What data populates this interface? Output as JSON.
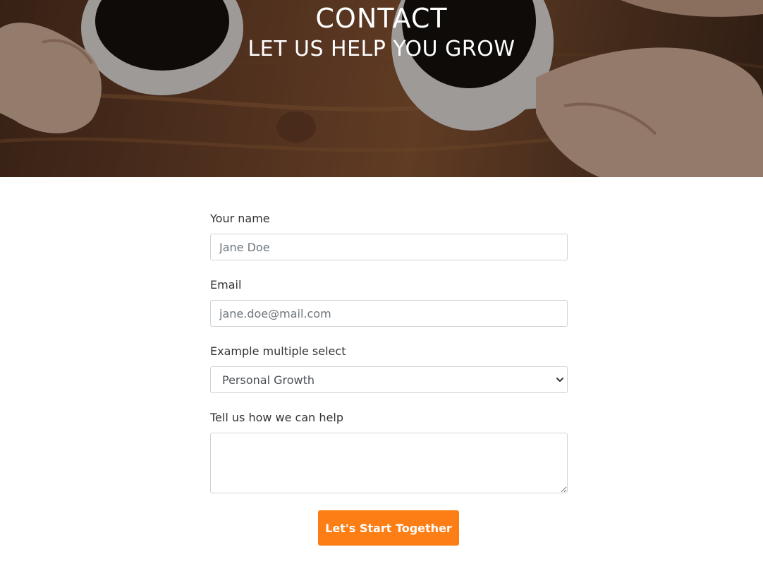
{
  "hero": {
    "title": "CONTACT",
    "subtitle": "LET US HELP YOU GROW"
  },
  "form": {
    "name": {
      "label": "Your name",
      "placeholder": "Jane Doe",
      "value": ""
    },
    "email": {
      "label": "Email",
      "placeholder": "jane.doe@mail.com",
      "value": ""
    },
    "select": {
      "label": "Example multiple select",
      "selected": "Personal Growth",
      "icon": "chevron-down-icon"
    },
    "message": {
      "label": "Tell us how we can help",
      "value": ""
    },
    "submit_label": "Let's Start Together"
  },
  "colors": {
    "accent": "#fd7e14",
    "hero_text": "#ffffff",
    "label_text": "#333333",
    "input_border": "#cfd4d9"
  }
}
